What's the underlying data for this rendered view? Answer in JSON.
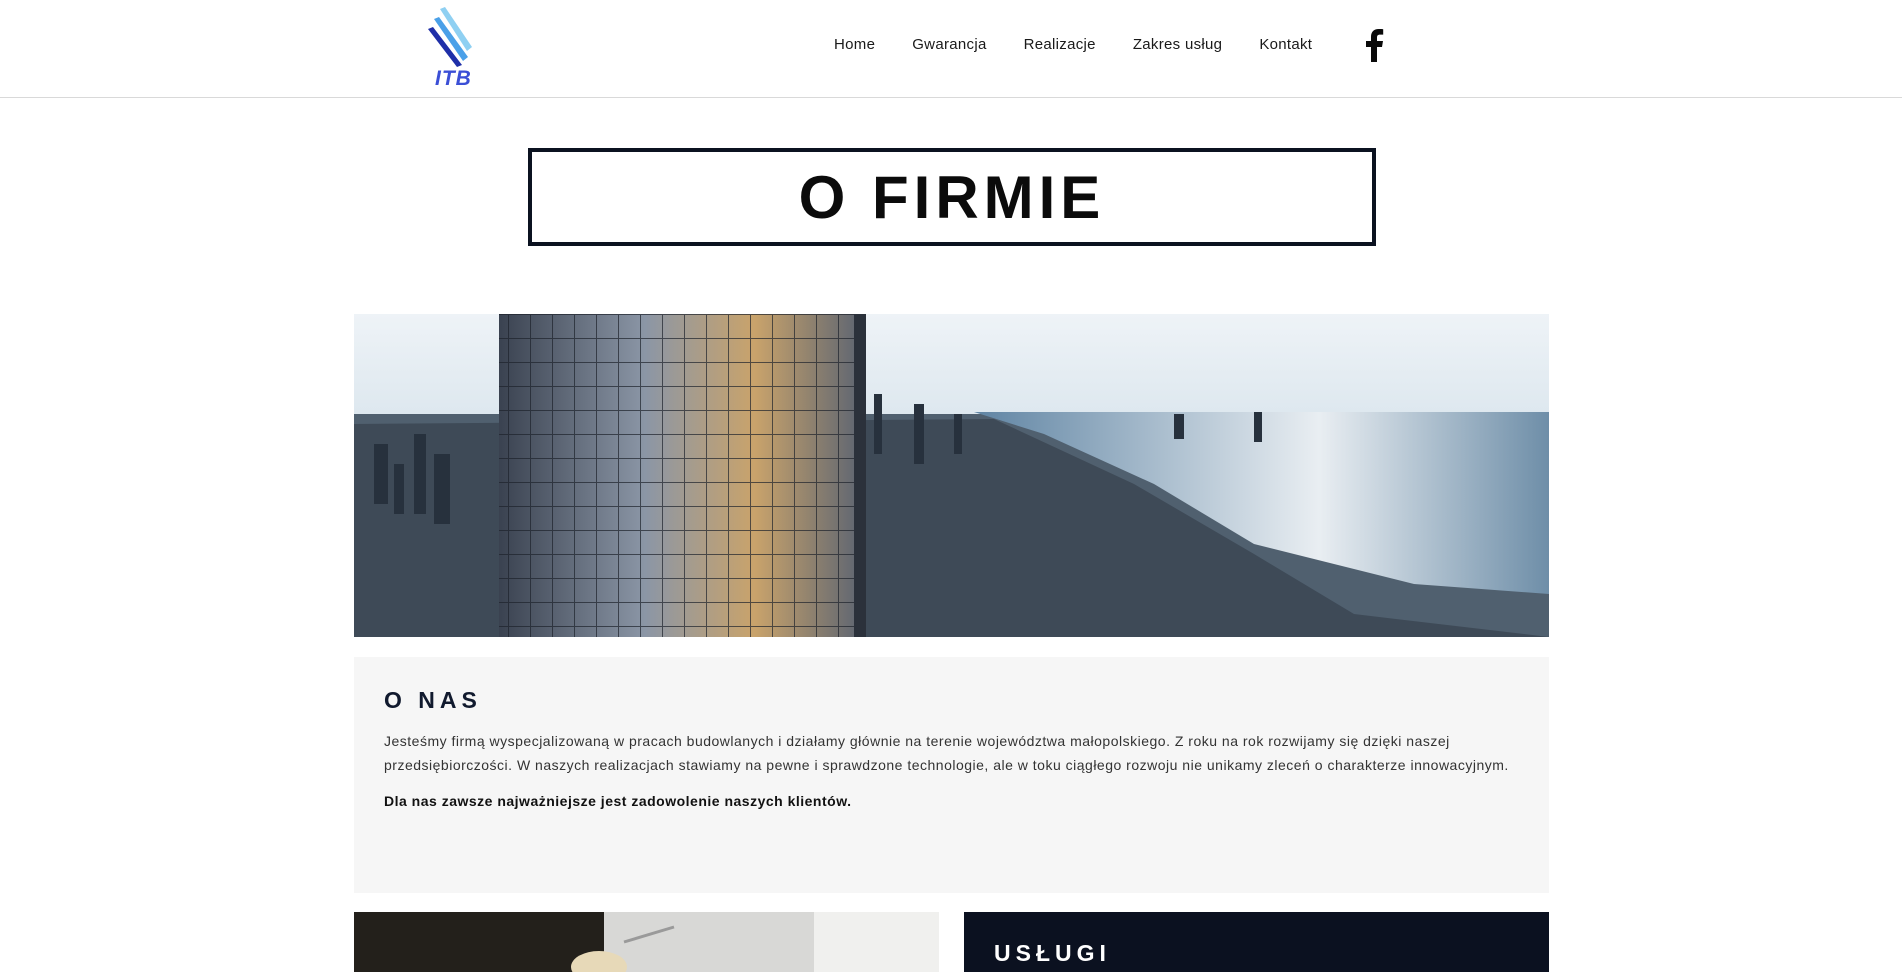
{
  "header": {
    "logo_text": "ITB",
    "nav": [
      "Home",
      "Gwarancja",
      "Realizacje",
      "Zakres usług",
      "Kontakt"
    ],
    "social_icon": "facebook-icon"
  },
  "hero_title": "O FIRMIE",
  "about": {
    "heading": "O NAS",
    "paragraph": "Jesteśmy firmą wyspecjalizowaną w pracach budowlanych i działamy głównie na terenie województwa małopolskiego. Z roku na rok rozwijamy się dzięki naszej przedsiębiorczości. W naszych realizacjach stawiamy na pewne i sprawdzone technologie, ale w toku ciągłego rozwoju nie unikamy zleceń o charakterze innowacyjnym.",
    "highlight": "Dla nas zawsze najważniejsze jest zadowolenie naszych klientów."
  },
  "services": {
    "heading": "USŁUGI"
  },
  "colors": {
    "dark_navy": "#0b1120",
    "panel_gray": "#f6f6f6",
    "logo_blue": "#3b4fd6"
  }
}
